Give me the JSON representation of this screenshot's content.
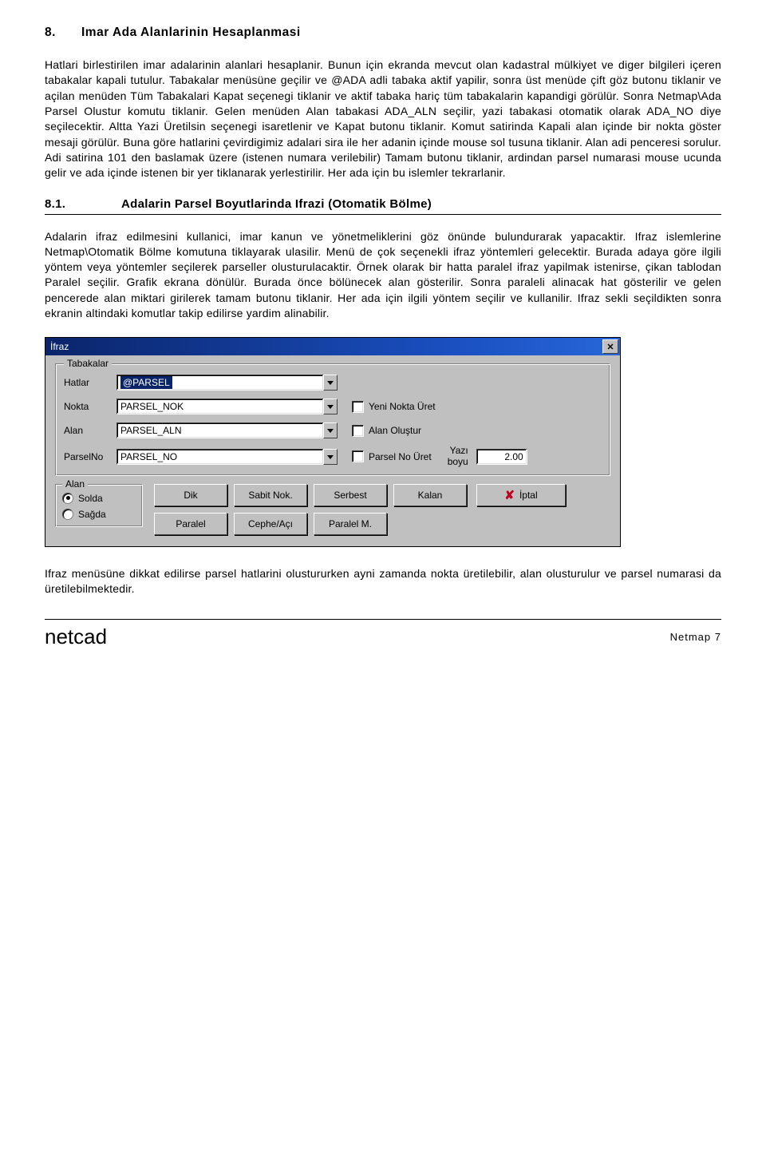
{
  "section": {
    "num": "8.",
    "title": "Imar Ada Alanlarinin Hesaplanmasi"
  },
  "para1": "Hatlari birlestirilen imar adalarinin alanlari hesaplanir. Bunun için ekranda mevcut olan kadastral mülkiyet ve diger bilgileri içeren tabakalar kapali tutulur. Tabakalar menüsüne geçilir ve @ADA adli tabaka aktif yapilir, sonra üst menüde çift göz butonu tiklanir ve açilan menüden Tüm Tabakalari Kapat seçenegi tiklanir ve aktif tabaka hariç tüm tabakalarin kapandigi görülür. Sonra Netmap\\Ada Parsel Olustur komutu tiklanir. Gelen menüden Alan tabakasi ADA_ALN seçilir, yazi tabakasi otomatik olarak ADA_NO diye seçilecektir. Altta Yazi Üretilsin seçenegi isaretlenir ve Kapat butonu tiklanir. Komut satirinda Kapali alan içinde bir nokta göster mesaji görülür. Buna göre hatlarini çevirdigimiz adalari sira ile her adanin içinde mouse sol tusuna tiklanir. Alan adi penceresi sorulur. Adi satirina 101 den baslamak üzere (istenen numara verilebilir) Tamam butonu tiklanir, ardindan parsel numarasi mouse ucunda gelir ve ada içinde istenen bir yer tiklanarak yerlestirilir. Her ada için bu islemler tekrarlanir.",
  "subsection": {
    "num": "8.1.",
    "title": "Adalarin Parsel Boyutlarinda Ifrazi (Otomatik Bölme)"
  },
  "para2": "Adalarin ifraz edilmesini kullanici, imar kanun ve yönetmeliklerini göz önünde bulundurarak yapacaktir. Ifraz islemlerine Netmap\\Otomatik Bölme komutuna tiklayarak ulasilir. Menü de çok seçenekli ifraz yöntemleri gelecektir. Burada adaya göre ilgili yöntem veya yöntemler seçilerek parseller olusturulacaktir. Örnek olarak bir hatta paralel ifraz yapilmak istenirse, çikan tablodan Paralel seçilir. Grafik ekrana dönülür. Burada önce bölünecek alan gösterilir. Sonra paraleli alinacak hat gösterilir ve gelen pencerede alan miktari girilerek tamam butonu tiklanir. Her ada için ilgili yöntem seçilir ve kullanilir. Ifraz sekli seçildikten sonra ekranin altindaki komutlar takip edilirse yardim alinabilir.",
  "dialog": {
    "title": "İfraz",
    "group_tabakalar": "Tabakalar",
    "labels": {
      "hatlar": "Hatlar",
      "nokta": "Nokta",
      "alan": "Alan",
      "parselno": "ParselNo"
    },
    "values": {
      "hatlar": "@PARSEL",
      "nokta": "PARSEL_NOK",
      "alan": "PARSEL_ALN",
      "parselno": "PARSEL_NO"
    },
    "checks": {
      "yeniNokta": "Yeni Nokta Üret",
      "alanOlustur": "Alan Oluştur",
      "parselNoUret": "Parsel No Üret"
    },
    "yazi": {
      "l1": "Yazı",
      "l2": "boyu",
      "val": "2.00"
    },
    "group_alan": "Alan",
    "radios": {
      "solda": "Solda",
      "sagda": "Sağda"
    },
    "buttons": {
      "dik": "Dik",
      "sabit": "Sabit Nok.",
      "serbest": "Serbest",
      "kalan": "Kalan",
      "paralel": "Paralel",
      "cephe": "Cephe/Açı",
      "paralelm": "Paralel M."
    },
    "cancel": "İptal"
  },
  "para3": "Ifraz menüsüne dikkat edilirse parsel hatlarini olustururken ayni zamanda nokta üretilebilir, alan olusturulur ve parsel numarasi da üretilebilmektedir.",
  "footer": {
    "logo": "netcad",
    "page": "Netmap  7"
  }
}
